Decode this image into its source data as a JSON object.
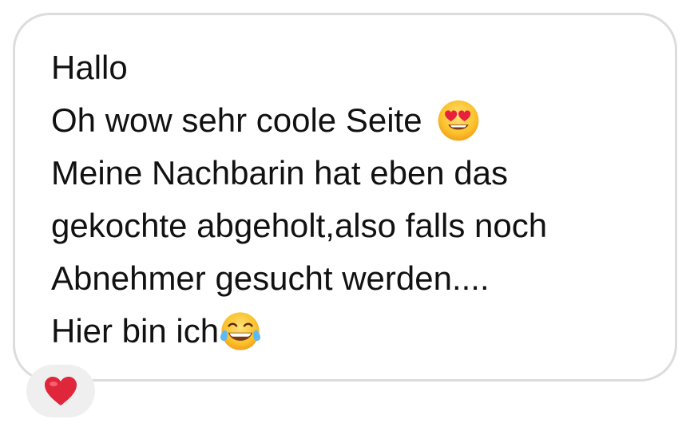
{
  "message": {
    "lines": [
      "Hallo",
      "Oh wow sehr coole Seite",
      "Meine Nachbarin hat eben das",
      "gekochte abgeholt,also falls noch",
      "Abnehmer gesucht werden....",
      "Hier bin ich"
    ],
    "emojis": {
      "line2": "heart-eyes-emoji",
      "line6": "tears-of-joy-emoji"
    }
  },
  "reaction": {
    "icon": "red-heart-icon",
    "color": "#e0263a"
  },
  "colors": {
    "bubble_border": "#dcdcdc",
    "reaction_bg": "#efefef",
    "text": "#111111"
  }
}
